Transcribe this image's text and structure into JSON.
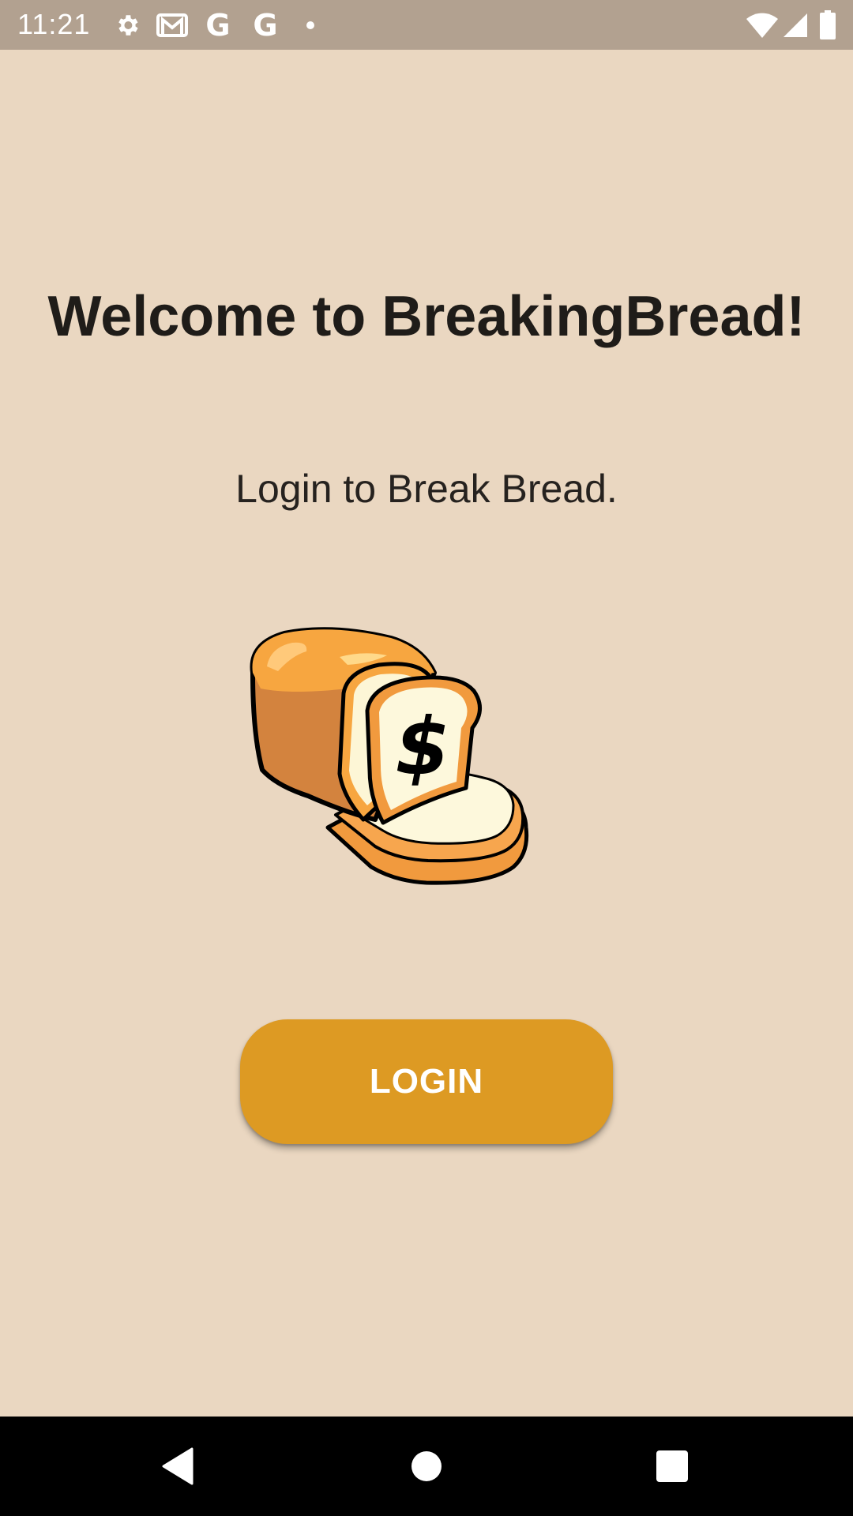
{
  "status_bar": {
    "time": "11:21",
    "icons": [
      "settings-icon",
      "gmail-icon",
      "google-icon",
      "google-icon",
      "notification-dot-icon",
      "wifi-icon",
      "cellular-signal-icon",
      "battery-icon"
    ],
    "google_letter": "G"
  },
  "main": {
    "title": "Welcome to BreakingBread!",
    "subtitle": "Login to Break Bread.",
    "logo_icon": "bread-dollar-logo",
    "login_label": "LOGIN"
  },
  "nav_bar": {
    "icons": [
      "back-icon",
      "home-icon",
      "recents-icon"
    ]
  },
  "colors": {
    "background": "#EAD7C1",
    "status_bar": "#B2A190",
    "button": "#DD9A23",
    "title_text": "#1F1C19"
  }
}
